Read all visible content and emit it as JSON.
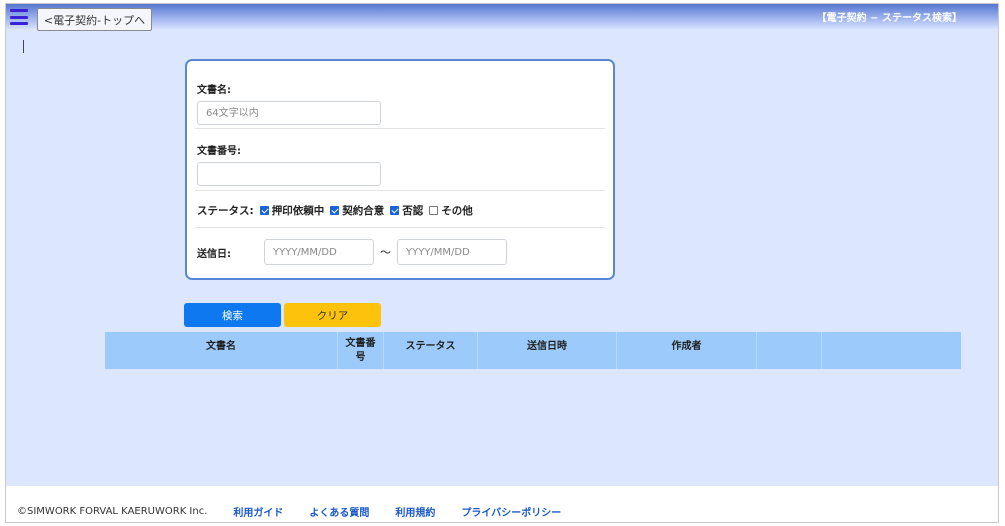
{
  "header": {
    "back_label": "<電子契約-トップへ",
    "title": "【電子契約 − ステータス検索】"
  },
  "form": {
    "doc_name": {
      "label": "文書名:",
      "placeholder": "64文字以内",
      "value": ""
    },
    "doc_number": {
      "label": "文書番号:",
      "placeholder": "",
      "value": ""
    },
    "status": {
      "label": "ステータス:",
      "options": [
        {
          "label": "押印依頼中",
          "checked": true
        },
        {
          "label": "契約合意",
          "checked": true
        },
        {
          "label": "否認",
          "checked": true
        },
        {
          "label": "その他",
          "checked": false
        }
      ]
    },
    "send_date": {
      "label": "送信日:",
      "from_placeholder": "YYYY/MM/DD",
      "to_placeholder": "YYYY/MM/DD",
      "separator": "〜"
    }
  },
  "buttons": {
    "search": "検索",
    "clear": "クリア"
  },
  "table": {
    "columns": [
      "文書名",
      "文書番号",
      "ステータス",
      "送信日時",
      "作成者",
      "",
      ""
    ]
  },
  "footer": {
    "copyright": "©SIMWORK FORVAL KAERUWORK Inc.",
    "links": [
      "利用ガイド",
      "よくある質問",
      "利用規約",
      "プライバシーポリシー"
    ]
  },
  "colors": {
    "background": "#dce6ff",
    "header_bar": "#5577d0",
    "form_border": "#5a86d6",
    "search_button": "#0d78f0",
    "clear_button": "#fcc20c",
    "table_header": "#9ccbfb",
    "link": "#1858c9"
  }
}
